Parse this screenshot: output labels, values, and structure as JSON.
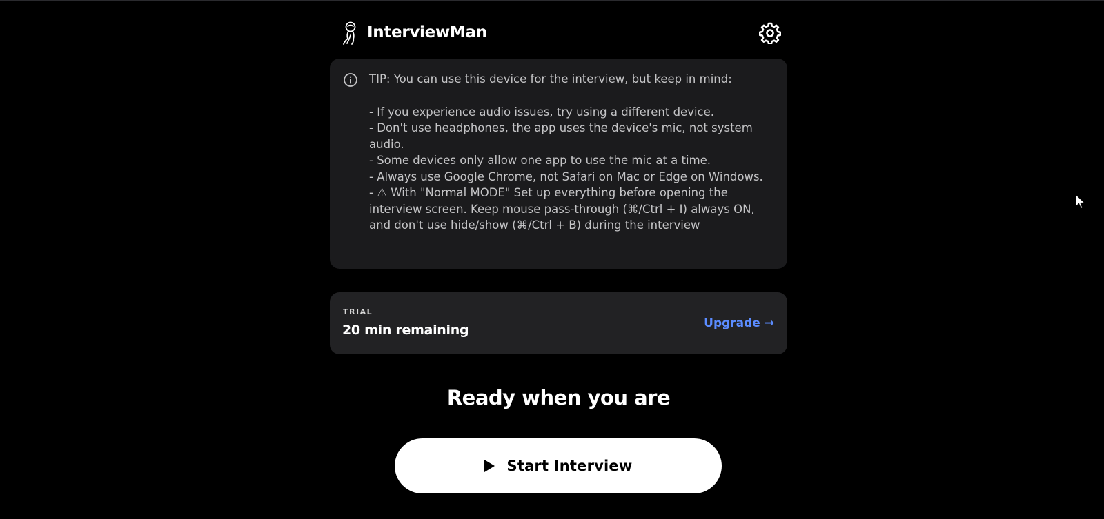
{
  "header": {
    "app_name": "InterviewMan",
    "logo_icon": "astronaut-icon",
    "settings_icon": "gear-icon"
  },
  "tip": {
    "icon": "info-icon",
    "lines": [
      "TIP: You can use this device for the interview, but keep in mind:",
      "- If you experience audio issues, try using a different device.",
      "- Don't use headphones, the app uses the device's mic, not system audio.",
      "- Some devices only allow one app to use the mic at a time.",
      "- Always use Google Chrome, not Safari on Mac or Edge on Windows.",
      "- ⚠ With \"Normal MODE\" Set up everything before opening the interview screen. Keep mouse pass-through (⌘/Ctrl + I) always ON, and don't use hide/show (⌘/Ctrl + B) during the interview"
    ]
  },
  "trial": {
    "label": "TRIAL",
    "remaining": "20 min remaining",
    "upgrade_label": "Upgrade →"
  },
  "main": {
    "heading": "Ready when you are",
    "start_button_label": "Start Interview",
    "start_icon": "play-icon"
  },
  "colors": {
    "background": "#000000",
    "card": "#1b1b1d",
    "trial_card": "#222224",
    "accent_link": "#5b8cff",
    "button": "#ffffff"
  }
}
